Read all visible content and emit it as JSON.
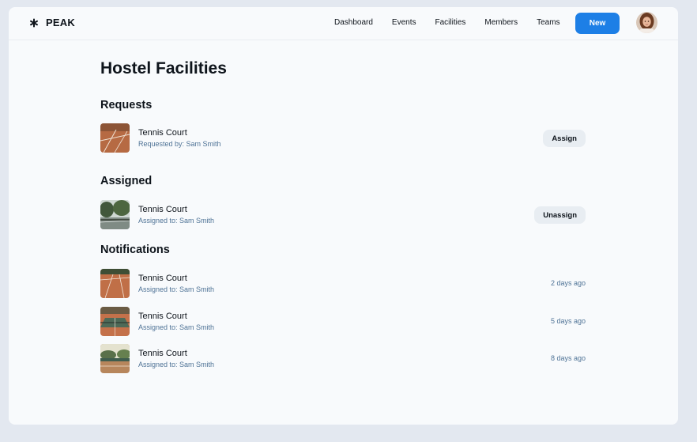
{
  "app": {
    "name": "PEAK",
    "logo_icon": "asterisk-logo-icon"
  },
  "nav": {
    "items": [
      {
        "label": "Dashboard"
      },
      {
        "label": "Events"
      },
      {
        "label": "Facilities"
      },
      {
        "label": "Members"
      },
      {
        "label": "Teams"
      }
    ],
    "new_label": "New",
    "accent": "#1d7fe6"
  },
  "page": {
    "title": "Hostel Facilities"
  },
  "requests": {
    "title": "Requests",
    "items": [
      {
        "name": "Tennis Court",
        "sub": "Requested by: Sam Smith",
        "action": "Assign"
      }
    ]
  },
  "assigned": {
    "title": "Assigned",
    "items": [
      {
        "name": "Tennis Court",
        "sub": "Assigned to: Sam Smith",
        "action": "Unassign"
      }
    ]
  },
  "notifications": {
    "title": "Notifications",
    "items": [
      {
        "name": "Tennis Court",
        "sub": "Assigned to: Sam Smith",
        "time": "2 days ago"
      },
      {
        "name": "Tennis Court",
        "sub": "Assigned to: Sam Smith",
        "time": "5 days ago"
      },
      {
        "name": "Tennis Court",
        "sub": "Assigned to: Sam Smith",
        "time": "8 days ago"
      }
    ]
  },
  "colors": {
    "subtext": "#4f7396",
    "pill_bg": "#e8edf2",
    "text": "#0e141b"
  }
}
